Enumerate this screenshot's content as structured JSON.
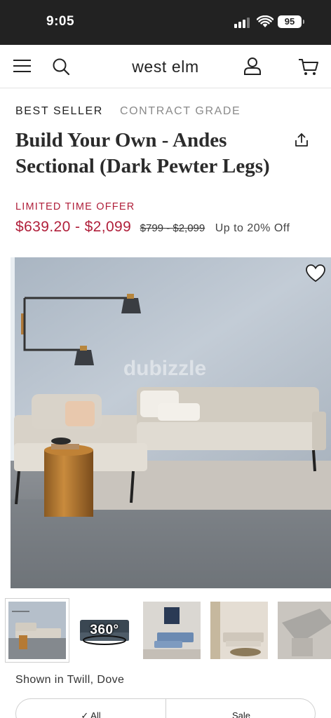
{
  "status_bar": {
    "time": "9:05",
    "battery": "95"
  },
  "nav": {
    "logo": "west elm"
  },
  "product": {
    "badges": {
      "best_seller": "BEST SELLER",
      "contract": "CONTRACT GRADE"
    },
    "title": "Build Your Own - Andes Sectional (Dark Pewter Legs)",
    "offer_label": "LIMITED TIME OFFER",
    "sale_price": "$639.20 - $2,099",
    "original_price": "$799 - $2,099",
    "discount": "Up to 20% Off",
    "watermark": "dubizzle",
    "thumbnails": [
      {
        "name": "main-view"
      },
      {
        "name": "360-view",
        "label": "360°"
      },
      {
        "name": "chaise-view"
      },
      {
        "name": "room-view"
      },
      {
        "name": "top-view"
      }
    ],
    "shown_in": "Shown in Twill, Dove",
    "filters": {
      "all": "All",
      "sale": "Sale"
    }
  }
}
